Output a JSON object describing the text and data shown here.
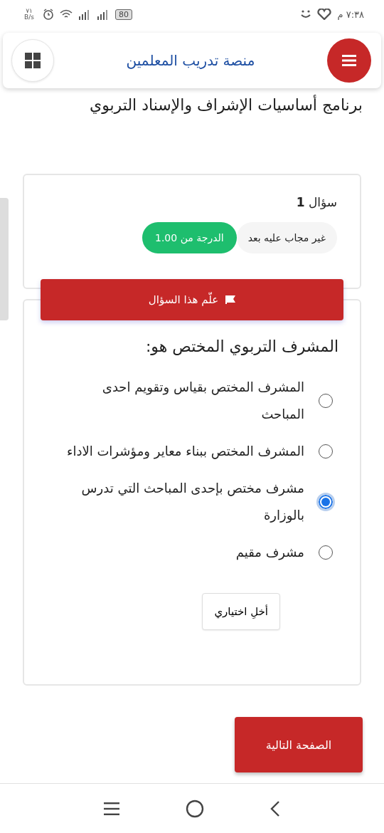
{
  "status_bar": {
    "time": "٧:٣٨ م",
    "speed": "٧١ B/s",
    "battery": "80"
  },
  "header": {
    "title": "منصة تدريب المعلمين"
  },
  "page_title": "برنامج أساسيات الإشراف والإسناد التربوي",
  "question_info": {
    "title": "سؤال **1**",
    "status": "غير مجاب عليه بعد",
    "grade": "الدرجة من 1.00",
    "flag_button": "علّم هذا السؤال"
  },
  "question": {
    "text": "المشرف التربوي المختص هو:",
    "options": [
      {
        "label": "المشرف المختص  بقياس وتقويم احدى المباحث",
        "selected": false
      },
      {
        "label": "المشرف المختص ببناء معاير ومؤشرات الاداء",
        "selected": false
      },
      {
        "label": "مشرف مختص بإحدى المباحث التي تدرس بالوزارة",
        "selected": true
      },
      {
        "label": "مشرف مقيم",
        "selected": false
      }
    ],
    "clear_button": "أخلِ اختياري"
  },
  "next_button": "الصفحة التالية"
}
